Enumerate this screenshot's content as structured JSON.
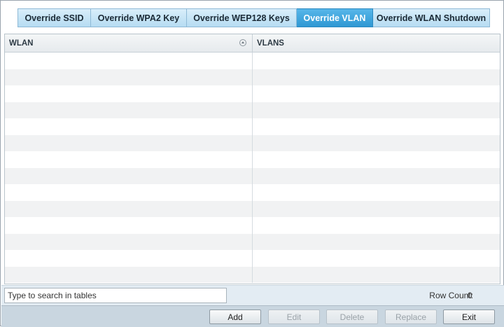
{
  "tabs": [
    {
      "label": "Override SSID",
      "active": false
    },
    {
      "label": "Override WPA2 Key",
      "active": false
    },
    {
      "label": "Override WEP128 Keys",
      "active": false
    },
    {
      "label": "Override VLAN",
      "active": true
    },
    {
      "label": "Override WLAN Shutdown",
      "active": false
    }
  ],
  "table": {
    "columns": [
      "WLAN",
      "VLANS"
    ],
    "sort_icon": "sort-ascending-icon",
    "rows": []
  },
  "footer": {
    "search_placeholder": "Type to search in tables",
    "row_count_label": "Row Count:",
    "row_count_value": "0"
  },
  "buttons": {
    "add": "Add",
    "edit": "Edit",
    "delete": "Delete",
    "replace": "Replace",
    "exit": "Exit"
  },
  "colors": {
    "active_tab": "#3aa3dc",
    "inactive_tab": "#c4e3f6"
  }
}
